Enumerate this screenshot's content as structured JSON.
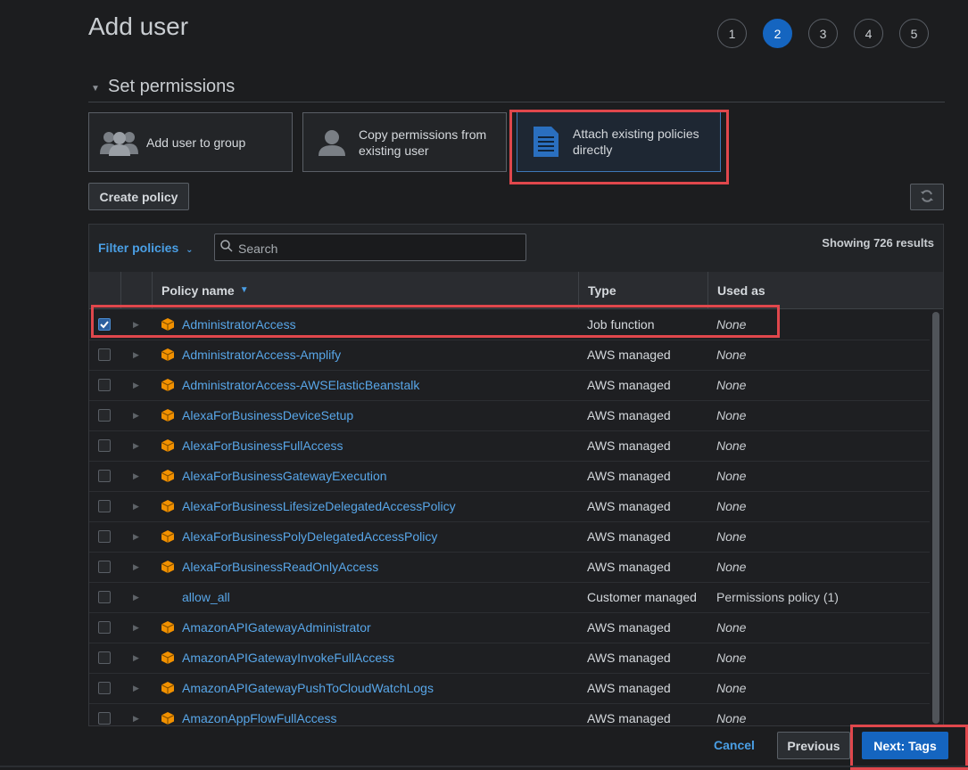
{
  "page": {
    "title": "Add user"
  },
  "steps": [
    "1",
    "2",
    "3",
    "4",
    "5"
  ],
  "active_step": "2",
  "section": {
    "title": "Set permissions"
  },
  "options": {
    "add_to_group": "Add user to group",
    "copy_line1": "Copy permissions from",
    "copy_line2": "existing user",
    "attach_line1": "Attach existing policies",
    "attach_line2": "directly"
  },
  "toolbar": {
    "create_policy": "Create policy",
    "refresh_icon": "refresh-icon"
  },
  "filter": {
    "label": "Filter policies",
    "search_placeholder": "Search",
    "showing": "Showing 726 results"
  },
  "table": {
    "columns": {
      "name": "Policy name",
      "type": "Type",
      "used": "Used as"
    },
    "rows": [
      {
        "name": "AdministratorAccess",
        "type": "Job function",
        "used": "None",
        "checked": true,
        "icon": true
      },
      {
        "name": "AdministratorAccess-Amplify",
        "type": "AWS managed",
        "used": "None",
        "checked": false,
        "icon": true
      },
      {
        "name": "AdministratorAccess-AWSElasticBeanstalk",
        "type": "AWS managed",
        "used": "None",
        "checked": false,
        "icon": true
      },
      {
        "name": "AlexaForBusinessDeviceSetup",
        "type": "AWS managed",
        "used": "None",
        "checked": false,
        "icon": true
      },
      {
        "name": "AlexaForBusinessFullAccess",
        "type": "AWS managed",
        "used": "None",
        "checked": false,
        "icon": true
      },
      {
        "name": "AlexaForBusinessGatewayExecution",
        "type": "AWS managed",
        "used": "None",
        "checked": false,
        "icon": true
      },
      {
        "name": "AlexaForBusinessLifesizeDelegatedAccessPolicy",
        "type": "AWS managed",
        "used": "None",
        "checked": false,
        "icon": true
      },
      {
        "name": "AlexaForBusinessPolyDelegatedAccessPolicy",
        "type": "AWS managed",
        "used": "None",
        "checked": false,
        "icon": true
      },
      {
        "name": "AlexaForBusinessReadOnlyAccess",
        "type": "AWS managed",
        "used": "None",
        "checked": false,
        "icon": true
      },
      {
        "name": "allow_all",
        "type": "Customer managed",
        "used": "Permissions policy (1)",
        "checked": false,
        "icon": false
      },
      {
        "name": "AmazonAPIGatewayAdministrator",
        "type": "AWS managed",
        "used": "None",
        "checked": false,
        "icon": true
      },
      {
        "name": "AmazonAPIGatewayInvokeFullAccess",
        "type": "AWS managed",
        "used": "None",
        "checked": false,
        "icon": true
      },
      {
        "name": "AmazonAPIGatewayPushToCloudWatchLogs",
        "type": "AWS managed",
        "used": "None",
        "checked": false,
        "icon": true
      },
      {
        "name": "AmazonAppFlowFullAccess",
        "type": "AWS managed",
        "used": "None",
        "checked": false,
        "icon": true
      }
    ]
  },
  "footer": {
    "cancel": "Cancel",
    "previous": "Previous",
    "next": "Next: Tags"
  },
  "colors": {
    "accent": "#1565c0",
    "link": "#58a6e8",
    "highlight": "#e0474c",
    "policy_icon": "#f29100"
  }
}
